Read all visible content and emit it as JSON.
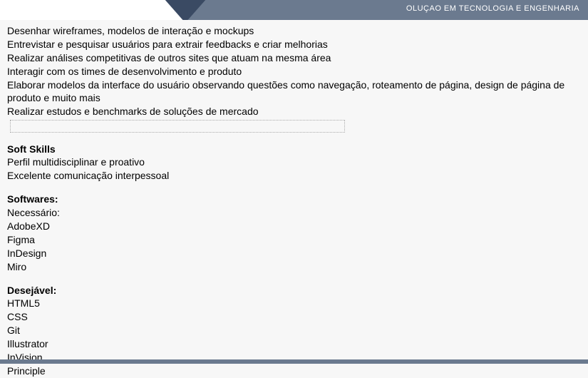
{
  "header": {
    "tagline": "OLUÇAO EM TECNOLOGIA E ENGENHARIA"
  },
  "responsibilities": {
    "items": [
      "Desenhar wireframes, modelos de interação e mockups",
      "Entrevistar e pesquisar usuários para extrair feedbacks e criar melhorias",
      "Realizar análises competitivas de outros sites que atuam na mesma área",
      "Interagir com os times de desenvolvimento  e produto",
      "Elaborar modelos da interface do usuário observando questões como navegação, roteamento de página, design de página de produto e muito mais",
      "Realizar estudos e benchmarks de soluções de mercado"
    ]
  },
  "soft_skills": {
    "heading": "Soft Skills",
    "items": [
      "Perfil multidisciplinar  e proativo",
      "Excelente comunicação interpessoal"
    ]
  },
  "softwares": {
    "heading": "Softwares:",
    "required_label": "Necessário:",
    "required_items": [
      "AdobeXD",
      "Figma",
      "InDesign",
      "Miro"
    ],
    "desirable_label": "Desejável:",
    "desirable_items": [
      "HTML5",
      "CSS",
      "Git",
      "Illustrator",
      "InVision",
      "Principle"
    ]
  }
}
